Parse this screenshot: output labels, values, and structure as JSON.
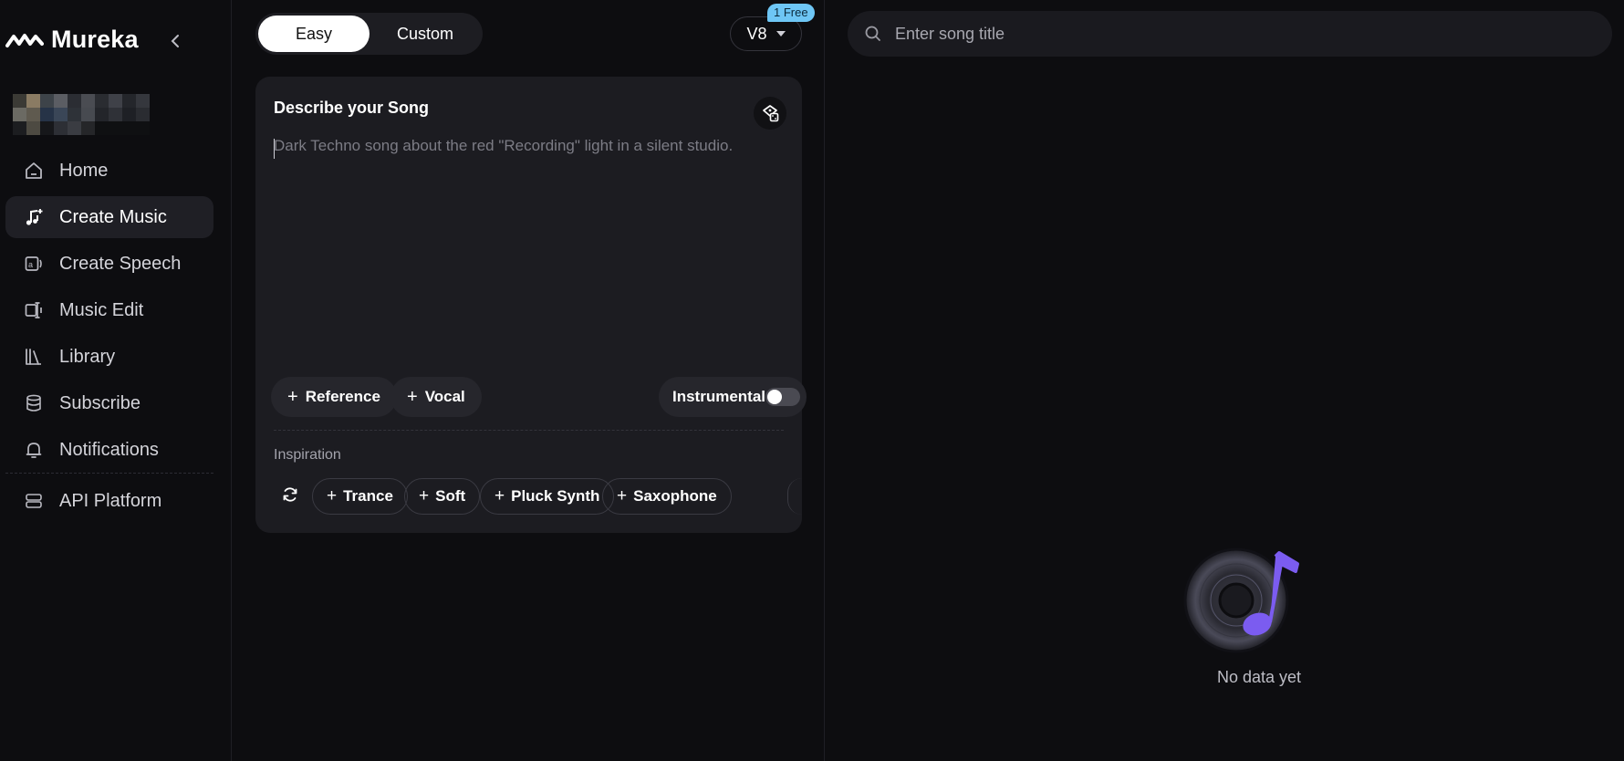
{
  "brand": {
    "name": "Mureka",
    "logo_icon": "mureka-wave-logo",
    "collapse_icon": "chevron-left-icon"
  },
  "sidebar": {
    "items": [
      {
        "label": "Home",
        "icon": "home-icon",
        "active": false
      },
      {
        "label": "Create Music",
        "icon": "music-note-plus-icon",
        "active": true
      },
      {
        "label": "Create Speech",
        "icon": "speech-icon",
        "active": false
      },
      {
        "label": "Music Edit",
        "icon": "music-edit-icon",
        "active": false
      },
      {
        "label": "Library",
        "icon": "library-icon",
        "active": false
      },
      {
        "label": "Subscribe",
        "icon": "database-icon",
        "active": false
      },
      {
        "label": "Notifications",
        "icon": "bell-icon",
        "active": false
      }
    ],
    "footer_items": [
      {
        "label": "API Platform",
        "icon": "server-icon"
      }
    ]
  },
  "create": {
    "modes": {
      "easy": "Easy",
      "custom": "Custom",
      "selected": "Easy"
    },
    "version": {
      "label": "V8",
      "badge": "1 Free"
    },
    "card": {
      "title": "Describe your Song",
      "prompt_placeholder": "Dark Techno song about the red \"Recording\" light in a silent studio.",
      "prompt_value": "",
      "reference_label": "Reference",
      "vocal_label": "Vocal",
      "instrumental_label": "Instrumental",
      "instrumental_on": false,
      "inspiration_label": "Inspiration",
      "inspiration_tags": [
        "Trance",
        "Soft",
        "Pluck Synth",
        "Saxophone"
      ]
    }
  },
  "library_panel": {
    "search_placeholder": "Enter song title",
    "empty_text": "No data yet"
  },
  "colors": {
    "accent_purple": "#7b5cf0",
    "badge_blue": "#6ec6f5",
    "active_bg": "#1f1f25"
  }
}
